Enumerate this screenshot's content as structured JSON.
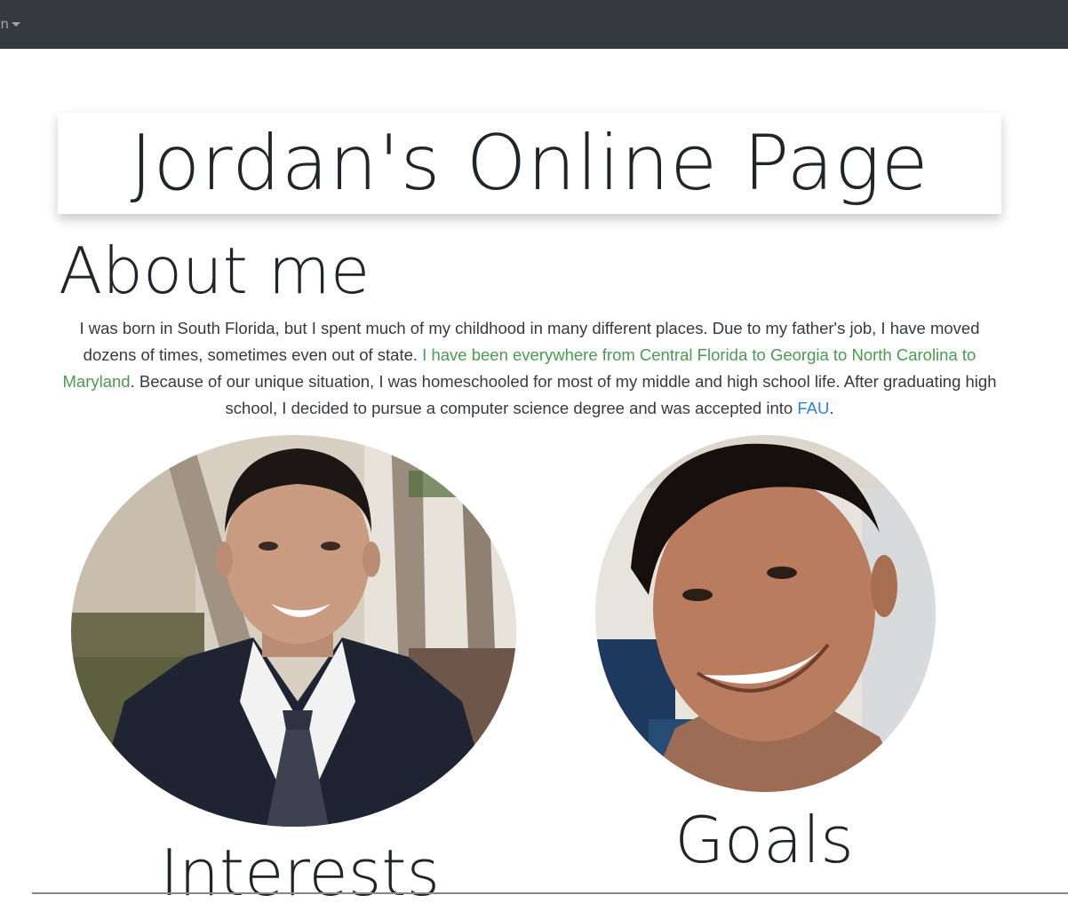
{
  "navbar": {
    "dropdown_label": "Dropdown",
    "background_color": "#343a40"
  },
  "header": {
    "title": "Jordan's Online Page"
  },
  "about": {
    "heading": "About me",
    "text_part1": "I was born in South Florida, but I spent much of my childhood in many different places. Due to my father's job, I have moved dozens of times, sometimes even out of state. ",
    "text_highlight": "I have been everywhere from Central Florida to Georgia to North Carolina to Maryland",
    "text_part2": ". Because of our unique situation, I was homeschooled for most of my middle and high school life. After graduating high school, I decided to pursue a computer science degree and was accepted into ",
    "link_text": "FAU",
    "text_part3": ".",
    "highlight_color": "#4a9a4f",
    "link_color": "#2b7de9"
  },
  "photos": [
    {
      "subject": "portrait-in-suit"
    },
    {
      "subject": "selfie-portrait"
    }
  ],
  "sections": {
    "interests_heading": "Interests",
    "goals_heading": "Goals"
  }
}
